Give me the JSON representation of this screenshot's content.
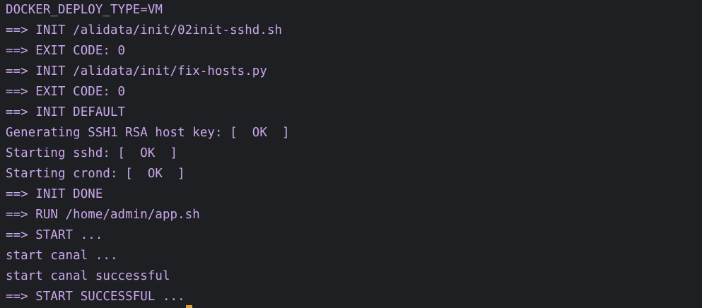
{
  "terminal": {
    "lines": [
      "DOCKER_DEPLOY_TYPE=VM",
      "==> INIT /alidata/init/02init-sshd.sh",
      "==> EXIT CODE: 0",
      "==> INIT /alidata/init/fix-hosts.py",
      "==> EXIT CODE: 0",
      "==> INIT DEFAULT",
      "Generating SSH1 RSA host key: [  OK  ]",
      "Starting sshd: [  OK  ]",
      "Starting crond: [  OK  ]",
      "==> INIT DONE",
      "==> RUN /home/admin/app.sh",
      "==> START ...",
      "start canal ...",
      "start canal successful",
      "==> START SUCCESSFUL ..."
    ]
  },
  "colors": {
    "background": "#1e1f22",
    "text": "#c9a8ee",
    "cursor": "#e0a040"
  }
}
